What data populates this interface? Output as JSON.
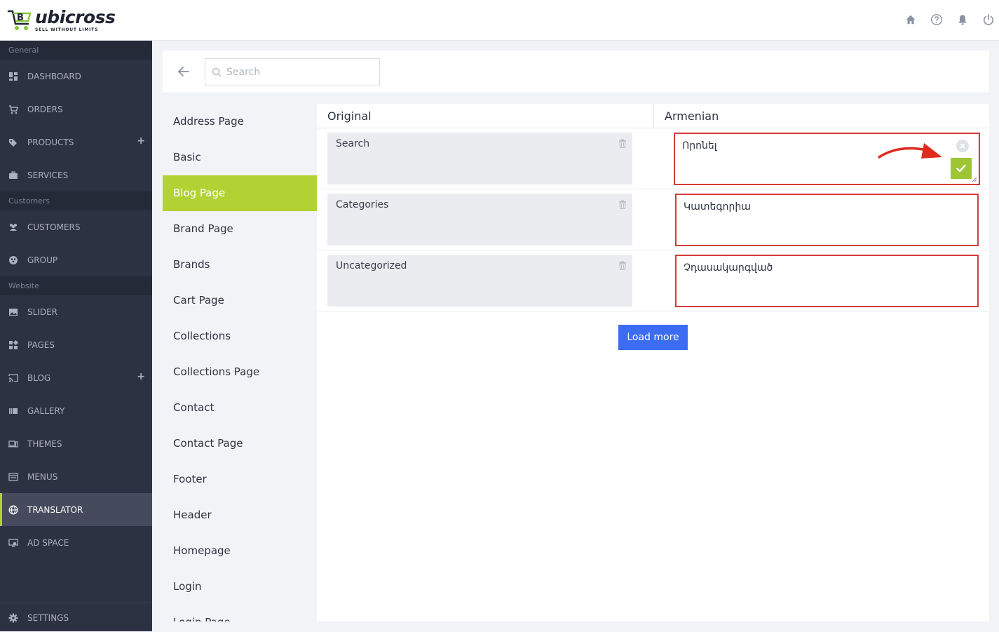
{
  "brand": {
    "name": "ubicross",
    "tagline": "SELL WITHOUT LIMITS",
    "accent": "#b2d234"
  },
  "topbar": {
    "icons": [
      "home-icon",
      "help-icon",
      "bell-icon",
      "power-icon"
    ]
  },
  "sidebar": {
    "sections": [
      {
        "label": "General",
        "items": [
          {
            "label": "DASHBOARD",
            "icon": "dashboard-icon"
          },
          {
            "label": "ORDERS",
            "icon": "cart-icon"
          },
          {
            "label": "PRODUCTS",
            "icon": "tags-icon",
            "plus": "+"
          },
          {
            "label": "SERVICES",
            "icon": "briefcase-icon"
          }
        ]
      },
      {
        "label": "Customers",
        "items": [
          {
            "label": "CUSTOMERS",
            "icon": "users-icon"
          },
          {
            "label": "GROUP",
            "icon": "group-icon"
          }
        ]
      },
      {
        "label": "Website",
        "items": [
          {
            "label": "SLIDER",
            "icon": "image-icon"
          },
          {
            "label": "PAGES",
            "icon": "pages-icon"
          },
          {
            "label": "BLOG",
            "icon": "cast-icon",
            "plus": "+"
          },
          {
            "label": "GALLERY",
            "icon": "gallery-icon"
          },
          {
            "label": "THEMES",
            "icon": "devices-icon"
          },
          {
            "label": "MENUS",
            "icon": "menu-icon"
          },
          {
            "label": "TRANSLATOR",
            "icon": "globe-icon",
            "active": true
          },
          {
            "label": "AD SPACE",
            "icon": "monitor-icon"
          }
        ]
      }
    ],
    "settings": {
      "label": "SETTINGS",
      "icon": "gear-icon"
    }
  },
  "search": {
    "placeholder": "Search",
    "value": ""
  },
  "categories": {
    "items": [
      "Address Page",
      "Basic",
      "Blog Page",
      "Brand Page",
      "Brands",
      "Cart Page",
      "Collections",
      "Collections Page",
      "Contact",
      "Contact Page",
      "Footer",
      "Header",
      "Homepage",
      "Login",
      "Login Page"
    ],
    "active": "Blog Page"
  },
  "table": {
    "original_header": "Original",
    "translated_header": "Armenian",
    "rows": [
      {
        "original": "Search",
        "translation": "Որոնել"
      },
      {
        "original": "Categories",
        "translation": "Կատեգորիա"
      },
      {
        "original": "Uncategorized",
        "translation": "Չդասակարգված"
      }
    ]
  },
  "load_more_label": "Load more"
}
